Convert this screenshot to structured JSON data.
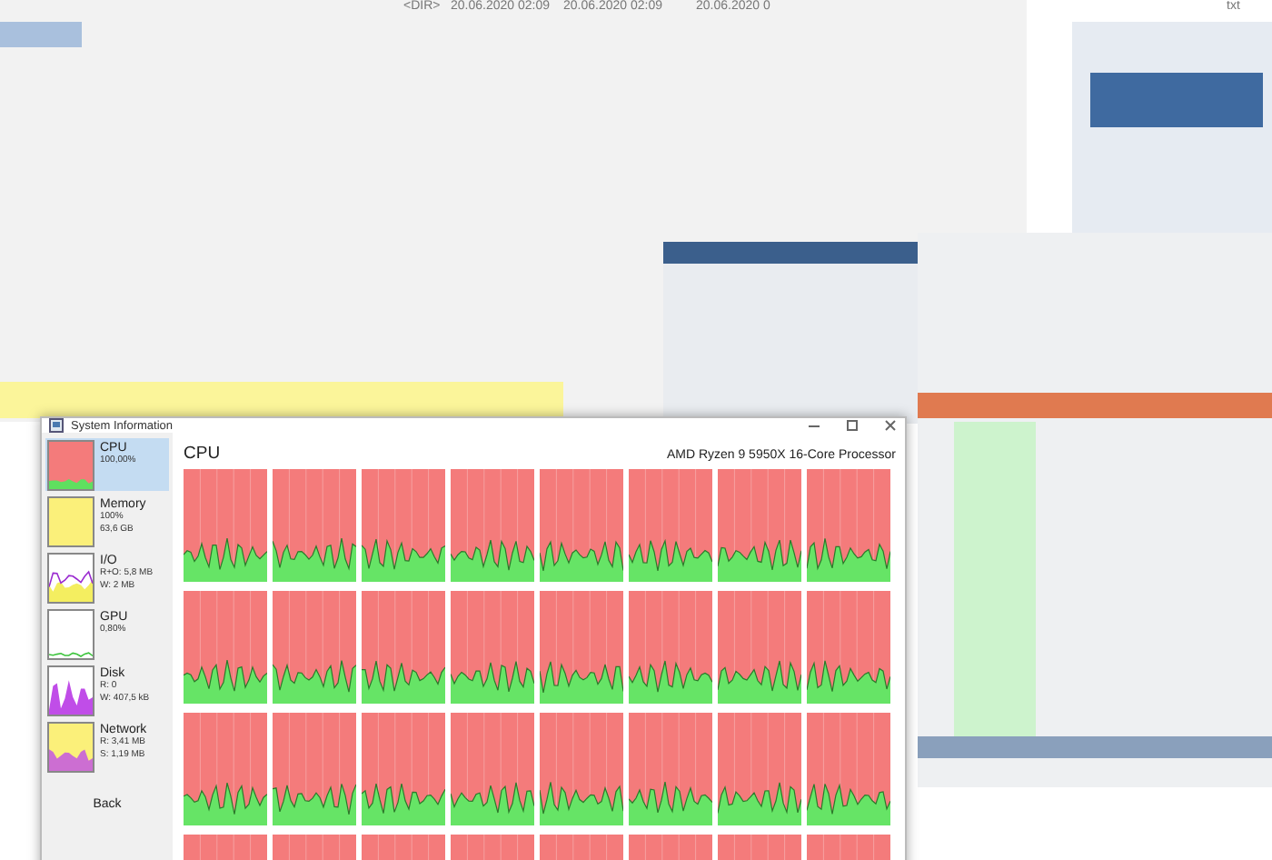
{
  "background": {
    "texts": [
      "<DIR>",
      "20.06.2020 02:09",
      "20.06.2020 02:09",
      "20.06.2020 0",
      "txt"
    ]
  },
  "window": {
    "title": "System Information"
  },
  "sidebar": {
    "items": [
      {
        "kind": "cpu",
        "name": "CPU",
        "lines": [
          "100,00%"
        ],
        "selected": true
      },
      {
        "kind": "memory",
        "name": "Memory",
        "lines": [
          "100%",
          "63,6 GB"
        ],
        "selected": false
      },
      {
        "kind": "io",
        "name": "I/O",
        "lines": [
          "R+O: 5,8 MB",
          "W: 2 MB"
        ],
        "selected": false
      },
      {
        "kind": "gpu",
        "name": "GPU",
        "lines": [
          "0,80%"
        ],
        "selected": false
      },
      {
        "kind": "disk",
        "name": "Disk",
        "lines": [
          "R: 0",
          "W: 407,5 kB"
        ],
        "selected": false
      },
      {
        "kind": "network",
        "name": "Network",
        "lines": [
          "R: 3,41 MB",
          "S: 1,19 MB"
        ],
        "selected": false
      }
    ],
    "back": "Back"
  },
  "panel": {
    "title": "CPU",
    "processor": "AMD Ryzen 9 5950X 16-Core Processor"
  }
}
